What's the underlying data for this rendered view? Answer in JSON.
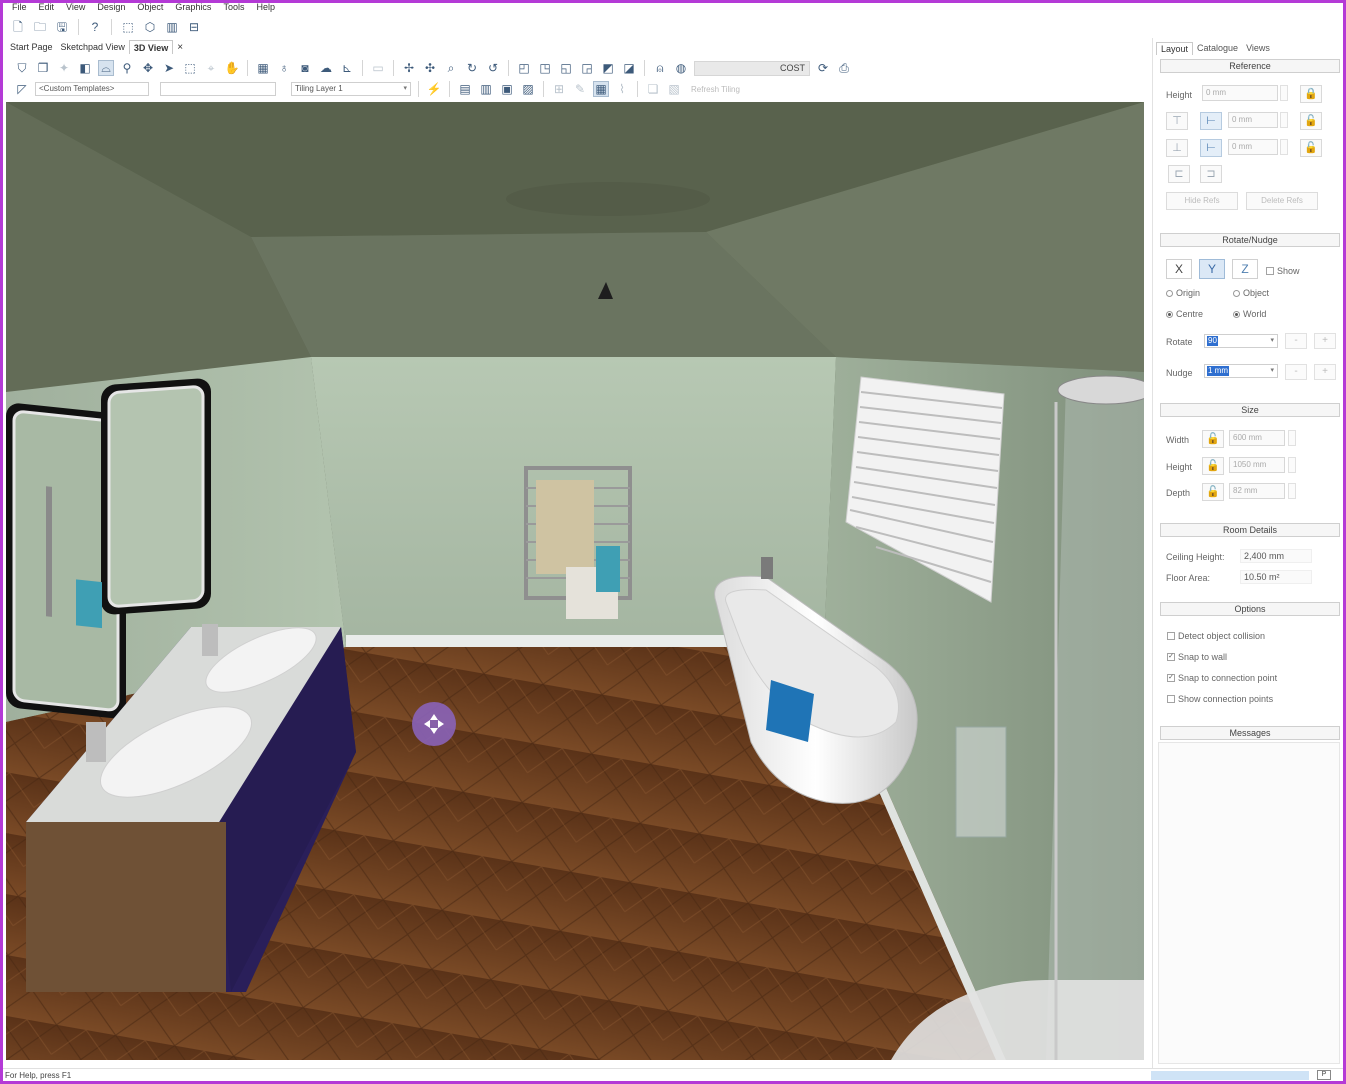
{
  "menu": [
    "File",
    "Edit",
    "View",
    "Design",
    "Object",
    "Graphics",
    "Tools",
    "Help"
  ],
  "tabs": [
    {
      "label": "Start Page",
      "active": false
    },
    {
      "label": "Sketchpad View",
      "active": false
    },
    {
      "label": "3D View",
      "active": true
    }
  ],
  "tab_close": "×",
  "toolbar": {
    "cost_label": "COST",
    "templates_combo": "<Custom Templates>",
    "layer_combo": "Tiling Layer 1",
    "refresh_tiling": "Refresh Tiling"
  },
  "panel_tabs": [
    "Layout",
    "Catalogue",
    "Views"
  ],
  "reference": {
    "header": "Reference",
    "height_label": "Height",
    "height_value": "0 mm",
    "offset1_value": "0 mm",
    "offset2_value": "0 mm",
    "hide_refs": "Hide Refs",
    "delete_refs": "Delete Refs"
  },
  "rotate_nudge": {
    "header": "Rotate/Nudge",
    "axes": [
      "X",
      "Y",
      "Z"
    ],
    "active_axis": "Y",
    "show_label": "Show",
    "origin": "Origin",
    "object": "Object",
    "centre": "Centre",
    "world": "World",
    "rotate_label": "Rotate",
    "rotate_value": "90",
    "nudge_label": "Nudge",
    "nudge_value": "1 mm",
    "minus": "-",
    "plus": "+"
  },
  "size": {
    "header": "Size",
    "width_label": "Width",
    "width_value": "600 mm",
    "height_label": "Height",
    "height_value": "1050 mm",
    "depth_label": "Depth",
    "depth_value": "82 mm"
  },
  "room_details": {
    "header": "Room Details",
    "ceiling_label": "Ceiling Height:",
    "ceiling_value": "2,400 mm",
    "floor_label": "Floor Area:",
    "floor_value": "10.50 m²"
  },
  "options": {
    "header": "Options",
    "items": [
      {
        "label": "Detect object collision",
        "checked": false
      },
      {
        "label": "Snap to wall",
        "checked": true
      },
      {
        "label": "Snap to connection point",
        "checked": true
      },
      {
        "label": "Show connection points",
        "checked": false
      }
    ]
  },
  "messages": {
    "header": "Messages"
  },
  "status": {
    "help_text": "For Help, press F1",
    "indicator": "P"
  },
  "colors": {
    "frame": "#b43ad6",
    "cursor": "#8a63b8",
    "floor": "#6a3c1c",
    "wall": "#a9b9a7",
    "ceiling": "#5c6550",
    "vanity": "#2b1f5a"
  }
}
